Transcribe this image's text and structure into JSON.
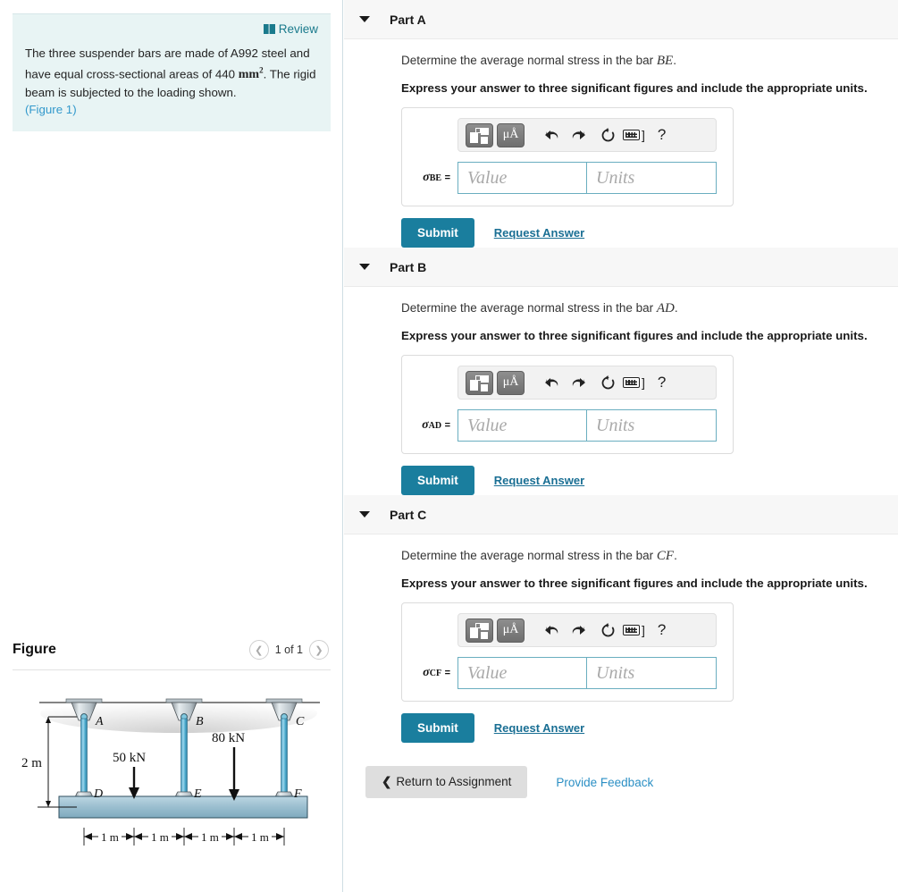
{
  "left": {
    "review_label": "Review",
    "review_icon": "book-icon",
    "problem_part1": "The three suspender bars are made of A992 steel and have equal cross-sectional areas of 440",
    "problem_unit": "mm",
    "problem_unit_sup": "2",
    "problem_part2": ". The rigid beam is subjected to the loading shown.",
    "figure_ref": "(Figure 1)",
    "figure_title": "Figure",
    "figure_count": "1 of 1",
    "prev_icon": "chevron-left-icon",
    "next_icon": "chevron-right-icon"
  },
  "figure": {
    "dimension_vertical": "2 m",
    "load_left": "50 kN",
    "load_right": "80 kN",
    "node_a": "A",
    "node_b": "B",
    "node_c": "C",
    "node_d": "D",
    "node_e": "E",
    "node_f": "F",
    "span1": "1 m",
    "span2": "1 m",
    "span3": "1 m",
    "span4": "1 m",
    "colors": {
      "bar": "#5fb3d4",
      "beam": "#8fb8ca",
      "bracket": "#c9d3d9"
    }
  },
  "toolbar": {
    "template_icon": "math-template-icon",
    "units_icon": "greek-units-icon",
    "units_label": "μÅ",
    "undo_icon": "undo-icon",
    "redo_icon": "redo-icon",
    "reset_icon": "reset-icon",
    "keyboard_icon": "keyboard-icon",
    "keyboard_bracket": "]",
    "help_icon": "help-icon",
    "help_label": "?"
  },
  "common": {
    "value_placeholder": "Value",
    "units_placeholder": "Units",
    "submit_label": "Submit",
    "request_answer_label": "Request Answer",
    "caret_icon": "caret-down-icon",
    "express_text": "Express your answer to three significant figures and include the appropriate units."
  },
  "parts": [
    {
      "id": "A",
      "header": "Part A",
      "question_prefix": "Determine the average normal stress in the bar ",
      "question_var": "BE",
      "question_suffix": ".",
      "sigma_base": "σ",
      "sigma_sub": "BE",
      "sigma_eq": "=",
      "value": "",
      "units": ""
    },
    {
      "id": "B",
      "header": "Part B",
      "question_prefix": "Determine the average normal stress in the bar ",
      "question_var": "AD",
      "question_suffix": ".",
      "sigma_base": "σ",
      "sigma_sub": "AD",
      "sigma_eq": "=",
      "value": "",
      "units": ""
    },
    {
      "id": "C",
      "header": "Part C",
      "question_prefix": "Determine the average normal stress in the bar ",
      "question_var": "CF",
      "question_suffix": ".",
      "sigma_base": "σ",
      "sigma_sub": "CF",
      "sigma_eq": "=",
      "value": "",
      "units": ""
    }
  ],
  "footer": {
    "return_label": "Return to Assignment",
    "return_icon": "chevron-left-icon",
    "feedback_label": "Provide Feedback"
  },
  "colors": {
    "accent": "#1a7e9e",
    "link": "#1a6f94",
    "problem_bg": "#e8f4f4",
    "part_header_bg": "#f7f7f7"
  }
}
